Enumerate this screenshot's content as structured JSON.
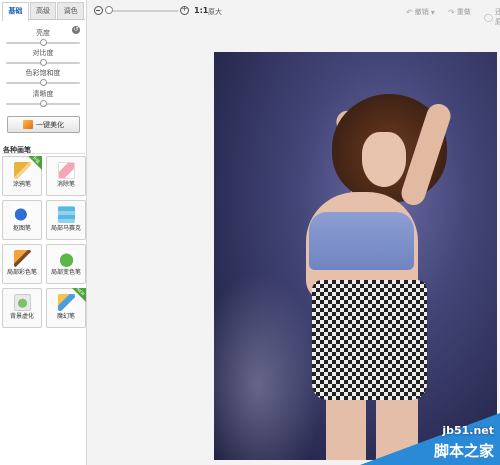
{
  "tabs": [
    "基础",
    "高级",
    "调色"
  ],
  "sliders": [
    "亮度",
    "对比度",
    "色彩饱和度",
    "清晰度"
  ],
  "beautify_button": "一键美化",
  "brushes": {
    "title": "各种画笔",
    "items": [
      {
        "label": "涂鸦笔",
        "icon": "pen-icon",
        "badge": "升级"
      },
      {
        "label": "消除笔",
        "icon": "eraser-icon",
        "badge": ""
      },
      {
        "label": "抠图笔",
        "icon": "cutout-pen-icon",
        "badge": ""
      },
      {
        "label": "局部马赛克",
        "icon": "mosaic-icon",
        "badge": ""
      },
      {
        "label": "局部彩色笔",
        "icon": "color-pen-icon",
        "badge": ""
      },
      {
        "label": "局部变色笔",
        "icon": "paint-bucket-icon",
        "badge": ""
      },
      {
        "label": "背景虚化",
        "icon": "blur-icon",
        "badge": ""
      },
      {
        "label": "魔幻笔",
        "icon": "magic-wand-icon",
        "badge": "NEW"
      }
    ]
  },
  "toolbar": {
    "ratio": "1:1",
    "original": "原大",
    "undo": "撤销",
    "redo": "重做",
    "reset": "还原"
  },
  "watermark": {
    "url": "jb51.net",
    "name": "脚本之家"
  }
}
